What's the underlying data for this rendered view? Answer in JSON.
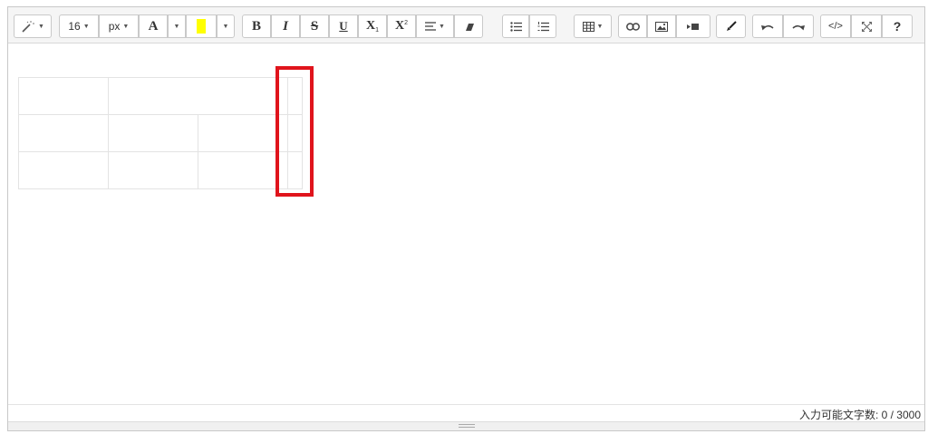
{
  "toolbar": {
    "font_size": "16",
    "font_unit": "px",
    "font_color_label": "A",
    "highlight_color": "#ffff00",
    "bold_label": "B",
    "italic_label": "I",
    "strike_label": "S",
    "underline_label": "U",
    "subscript_label": "X",
    "superscript_label": "X",
    "code_view_label": "</>",
    "help_label": "?"
  },
  "editor": {
    "table": {
      "rows": 3,
      "cols": 3
    }
  },
  "status": {
    "char_count": "入力可能文字数: 0 / 3000"
  },
  "colors": {
    "highlight_border": "#e0141c"
  }
}
